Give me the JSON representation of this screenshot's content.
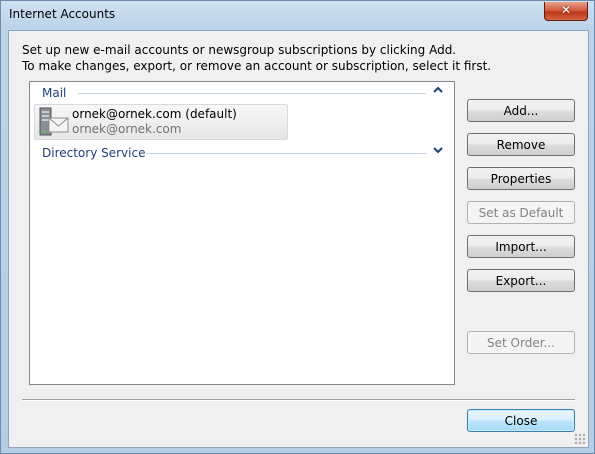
{
  "window": {
    "title": "Internet Accounts",
    "close_glyph": "✕"
  },
  "instructions": {
    "line1": "Set up new e-mail accounts or newsgroup subscriptions by clicking Add.",
    "line2": "To make changes, export, or remove an account or subscription, select it first."
  },
  "list": {
    "groups": [
      {
        "label": "Mail",
        "state": "expanded",
        "chevron_icon": "chevron-up-icon",
        "accounts": [
          {
            "name": "ornek@ornek.com (default)",
            "detail": "ornek@ornek.com",
            "icon": "mail-server-icon"
          }
        ]
      },
      {
        "label": "Directory Service",
        "state": "collapsed",
        "chevron_icon": "chevron-down-icon",
        "accounts": []
      }
    ]
  },
  "buttons": {
    "add": "Add...",
    "remove": "Remove",
    "properties": "Properties",
    "set_default": "Set as Default",
    "import": "Import...",
    "export": "Export...",
    "set_order": "Set Order...",
    "close": "Close"
  },
  "colors": {
    "group_header": "#1e3f7d",
    "title_gradient_top": "#cfe0f0",
    "close_button_red": "#c8452a",
    "default_button_blue": "#bee6fd"
  }
}
